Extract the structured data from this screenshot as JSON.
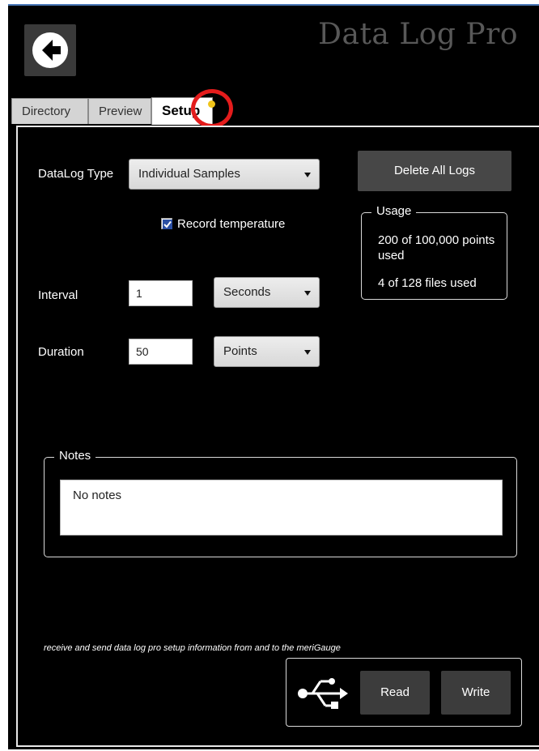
{
  "app": {
    "title": "Data Log Pro"
  },
  "tabs": [
    {
      "label": "Directory",
      "active": false
    },
    {
      "label": "Preview",
      "active": false
    },
    {
      "label": "Setup",
      "active": true
    }
  ],
  "setup": {
    "datalog_type": {
      "label": "DataLog Type",
      "value": "Individual Samples"
    },
    "record_temperature": {
      "label": "Record temperature",
      "checked": true
    },
    "interval": {
      "label": "Interval",
      "value": "1",
      "unit": "Seconds"
    },
    "duration": {
      "label": "Duration",
      "value": "50",
      "unit": "Points"
    },
    "delete_all_label": "Delete All Logs"
  },
  "usage": {
    "legend": "Usage",
    "points_line1": "200 of 100,000 points",
    "points_line2": "used",
    "files": "4 of 128 files used"
  },
  "notes": {
    "legend": "Notes",
    "value": "No notes"
  },
  "footer": {
    "hint": "receive and send data log pro setup information from and to the meriGauge",
    "read_label": "Read",
    "write_label": "Write"
  },
  "icons": {
    "back": "back-arrow-icon",
    "usb": "usb-icon",
    "check": "checkmark-icon"
  },
  "colors": {
    "background": "#000000",
    "accent_ring": "#e41c1c",
    "indicator_dot": "#f0c419",
    "button_bg": "#474747"
  }
}
